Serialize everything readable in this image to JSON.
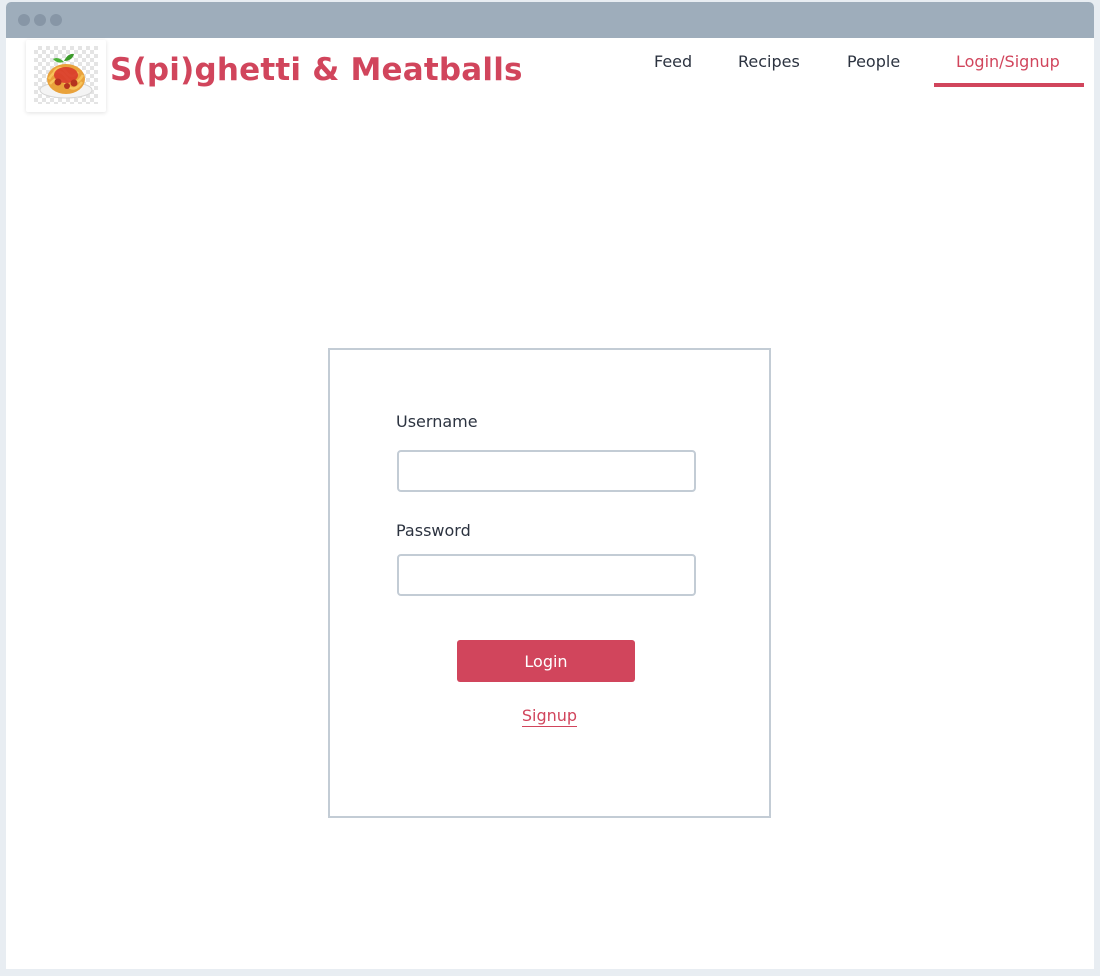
{
  "brand": {
    "title": "S(pi)ghetti & Meatballs",
    "logo_icon": "spaghetti-plate-icon"
  },
  "nav": {
    "items": [
      {
        "label": "Feed",
        "active": false
      },
      {
        "label": "Recipes",
        "active": false
      },
      {
        "label": "People",
        "active": false
      },
      {
        "label": "Login/Signup",
        "active": true
      }
    ]
  },
  "login_form": {
    "username_label": "Username",
    "username_value": "",
    "password_label": "Password",
    "password_value": "",
    "login_button": "Login",
    "signup_link": "Signup"
  },
  "colors": {
    "accent": "#d1455c",
    "titlebar": "#9eadbb",
    "border": "#c3ccd5",
    "text": "#2c3340"
  }
}
